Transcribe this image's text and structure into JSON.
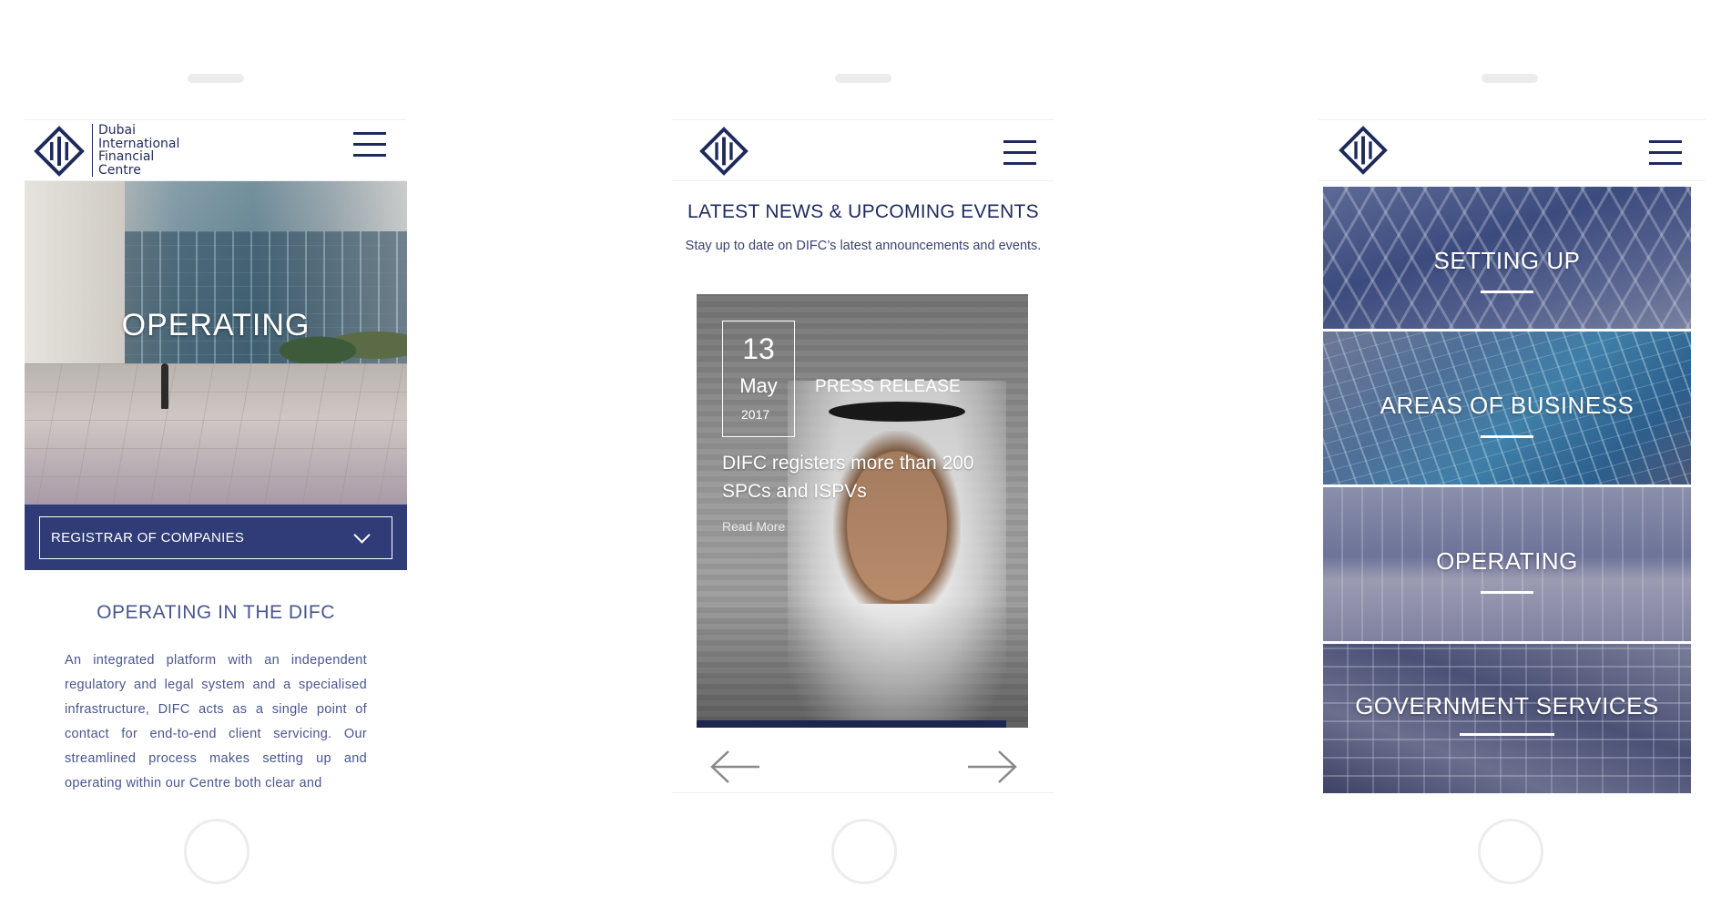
{
  "screen1": {
    "logo": {
      "icon": "difc-logo-icon",
      "text_lines": [
        "Dubai",
        "International",
        "Financial",
        "Centre"
      ]
    },
    "menu_icon": "hamburger-menu-icon",
    "hero_title": "OPERATING",
    "dropdown_label": "REGISTRAR OF COMPANIES",
    "dropdown_icon": "chevron-down-icon",
    "section_heading": "OPERATING IN THE DIFC",
    "body_text": "An integrated platform with an independent regulatory and legal system and a specialised infrastructure, DIFC acts as a single point of contact for end-to-end client servicing. Our streamlined process makes setting up and operating within our Centre both clear and"
  },
  "screen2": {
    "logo_icon": "difc-logo-icon",
    "menu_icon": "hamburger-menu-icon",
    "heading": "LATEST NEWS & UPCOMING EVENTS",
    "subheading": "Stay up to date on DIFC’s latest announcements and events.",
    "card": {
      "day": "13",
      "month": "May",
      "year": "2017",
      "category": "PRESS RELEASE",
      "title": "DIFC registers more than 200 SPCs and ISPVs",
      "read_more": "Read More"
    },
    "prev_icon": "arrow-left-icon",
    "next_icon": "arrow-right-icon"
  },
  "screen3": {
    "logo_icon": "difc-logo-icon",
    "menu_icon": "hamburger-menu-icon",
    "tiles": [
      {
        "label": "SETTING UP"
      },
      {
        "label": "AREAS OF BUSINESS"
      },
      {
        "label": "OPERATING"
      },
      {
        "label": "GOVERNMENT SERVICES"
      }
    ]
  },
  "colors": {
    "brand_navy": "#1f2a5c",
    "band_blue": "#2f3c78",
    "text_blue": "#4a5590"
  }
}
